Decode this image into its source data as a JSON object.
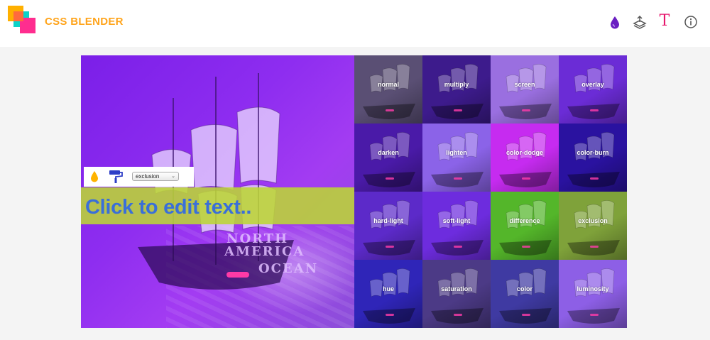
{
  "header": {
    "brand": "CSS BLENDER",
    "icons": [
      "drop-icon",
      "layers-icon",
      "text-t-icon",
      "info-icon"
    ],
    "colors": {
      "brand": "#ffa41b",
      "accent_purple": "#6a1fc2",
      "accent_pink": "#e6156b"
    }
  },
  "editor": {
    "blend_mode_selected": "exclusion",
    "edit_text": "Click to edit text..",
    "map_labels": [
      "NORTH",
      "AMERICA",
      "OCEAN"
    ]
  },
  "blend_modes": [
    "normal",
    "multiply",
    "screen",
    "overlay",
    "darken",
    "lighten",
    "color-dodge",
    "color-burn",
    "hard-light",
    "soft-light",
    "difference",
    "exclusion",
    "hue",
    "saturation",
    "color",
    "luminosity"
  ],
  "tile_colors": [
    "#5a4f74",
    "#3d1b8c",
    "#9a6fe0",
    "#6b2cd6",
    "#4a1aa8",
    "#8b63e8",
    "#c62bf0",
    "#2a12a0",
    "#5c2ac9",
    "#6d2cde",
    "#54b62a",
    "#7fa23a",
    "#2f25b8",
    "#4c3a86",
    "#3f3aa2",
    "#8d5fe6"
  ]
}
